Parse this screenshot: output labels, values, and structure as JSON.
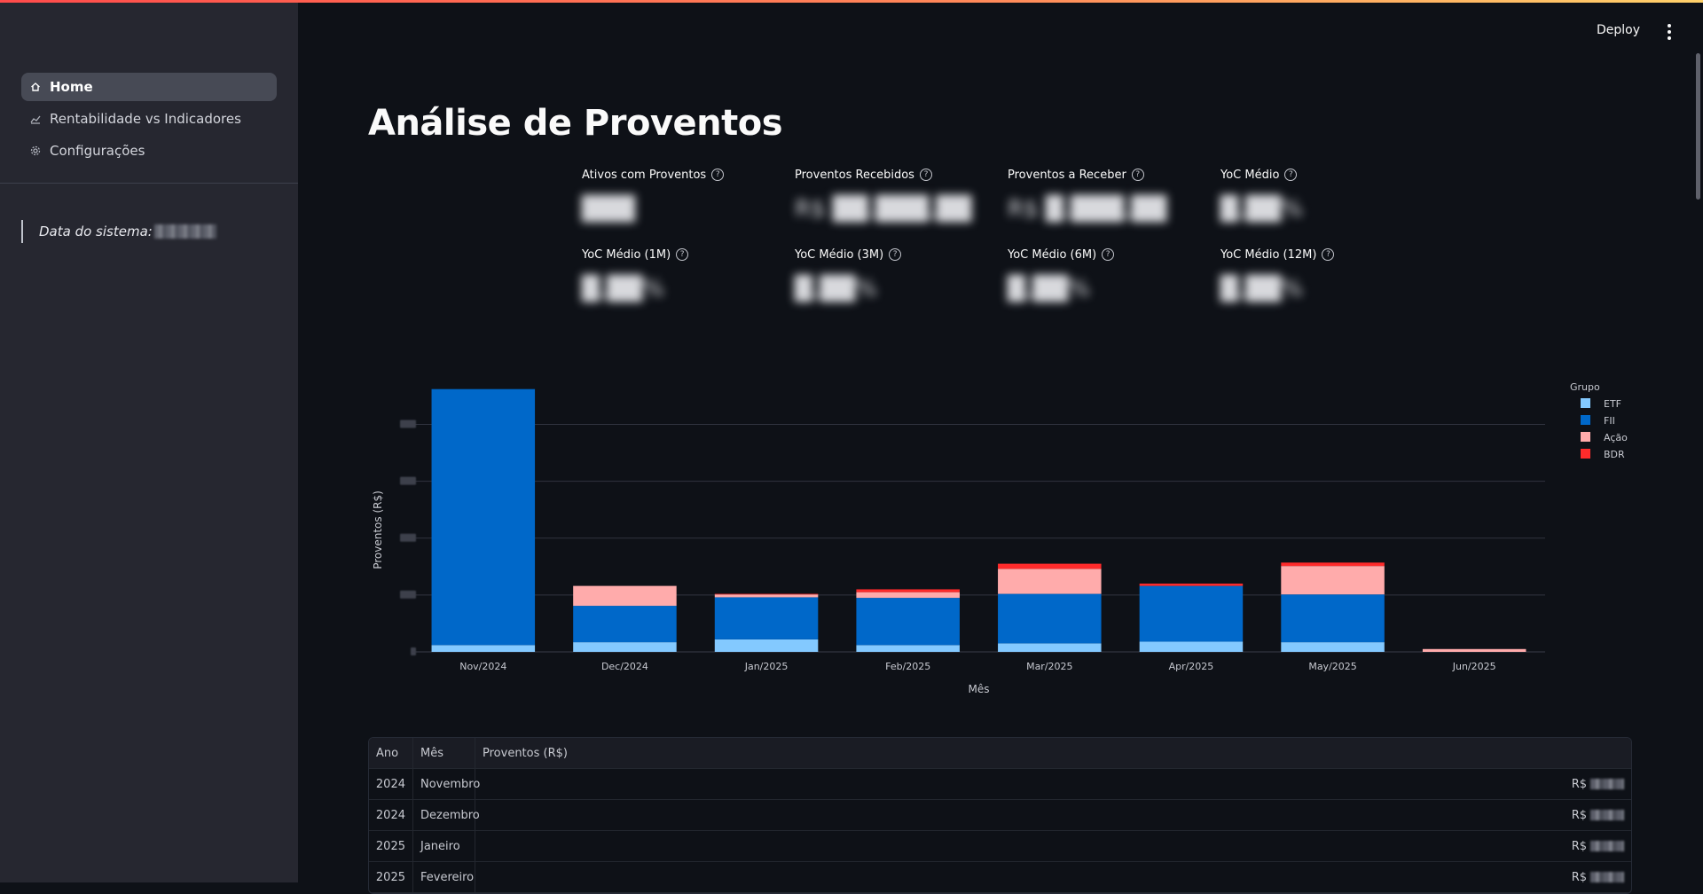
{
  "sidebar": {
    "items": [
      {
        "label": "Home",
        "icon": "home-icon",
        "active": true
      },
      {
        "label": "Rentabilidade vs Indicadores",
        "icon": "chart-icon",
        "active": false
      },
      {
        "label": "Configurações",
        "icon": "gear-icon",
        "active": false
      }
    ],
    "system_date_label": "Data do sistema:"
  },
  "header": {
    "deploy_label": "Deploy"
  },
  "page": {
    "title": "Análise de Proventos"
  },
  "metrics": [
    {
      "label": "Ativos com Proventos",
      "value": "███"
    },
    {
      "label": "Proventos Recebidos",
      "value": "R$ ██.███,██"
    },
    {
      "label": "Proventos a Receber",
      "value": "R$ █.███,██"
    },
    {
      "label": "YoC Médio",
      "value": "█,██%"
    },
    {
      "label": "YoC Médio (1M)",
      "value": "█,██%"
    },
    {
      "label": "YoC Médio (3M)",
      "value": "█,██%"
    },
    {
      "label": "YoC Médio (6M)",
      "value": "█,██%"
    },
    {
      "label": "YoC Médio (12M)",
      "value": "█,██%"
    }
  ],
  "chart_data": {
    "type": "bar",
    "stacked": true,
    "xlabel": "Mês",
    "ylabel": "Proventos (R$)",
    "categories": [
      "Nov/2024",
      "Dec/2024",
      "Jan/2025",
      "Feb/2025",
      "Mar/2025",
      "Apr/2025",
      "May/2025",
      "Jun/2025"
    ],
    "ylim": [
      0,
      4.6
    ],
    "yticks_obscured": true,
    "grid": true,
    "legend_title": "Grupo",
    "legend_position": "top-right",
    "series": [
      {
        "name": "ETF",
        "color": "#83c9ff",
        "values": [
          0.12,
          0.17,
          0.22,
          0.12,
          0.15,
          0.18,
          0.17,
          0.0
        ]
      },
      {
        "name": "FII",
        "color": "#0068c9",
        "values": [
          4.5,
          0.64,
          0.74,
          0.83,
          0.87,
          0.98,
          0.84,
          0.0
        ]
      },
      {
        "name": "Ação",
        "color": "#ffabab",
        "values": [
          0.0,
          0.35,
          0.05,
          0.1,
          0.44,
          0.0,
          0.5,
          0.05
        ]
      },
      {
        "name": "BDR",
        "color": "#ff2b2b",
        "values": [
          0.0,
          0.0,
          0.01,
          0.05,
          0.09,
          0.04,
          0.06,
          0.0
        ]
      }
    ]
  },
  "table": {
    "columns": [
      "Ano",
      "Mês",
      "Proventos (R$)"
    ],
    "rows": [
      {
        "ano": "2024",
        "mes": "Novembro",
        "prov": "R$"
      },
      {
        "ano": "2024",
        "mes": "Dezembro",
        "prov": "R$"
      },
      {
        "ano": "2025",
        "mes": "Janeiro",
        "prov": "R$"
      },
      {
        "ano": "2025",
        "mes": "Fevereiro",
        "prov": "R$"
      }
    ]
  }
}
